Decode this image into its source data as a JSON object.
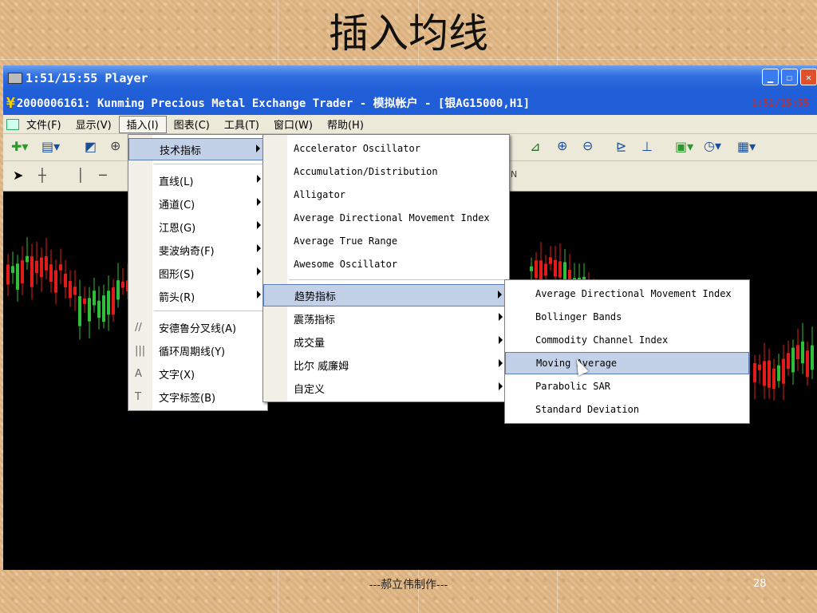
{
  "slide": {
    "title": "插入均线",
    "footer": "---郝立伟制作---",
    "page_number": "28"
  },
  "window": {
    "player_title": "1:51/15:55 Player",
    "app_title": "2000006161: Kunming Precious Metal Exchange Trader - 模拟帐户 - [银AG15000,H1]",
    "app_title_time": "1:51/15:55"
  },
  "menubar": {
    "items": [
      {
        "label": "文件(F)"
      },
      {
        "label": "显示(V)"
      },
      {
        "label": "插入(I)"
      },
      {
        "label": "图表(C)"
      },
      {
        "label": "工具(T)"
      },
      {
        "label": "窗口(W)"
      },
      {
        "label": "帮助(H)"
      }
    ]
  },
  "insert_menu": {
    "items": [
      {
        "label": "技术指标",
        "icon": ""
      },
      {
        "label": "直线(L)",
        "icon": ""
      },
      {
        "label": "通道(C)",
        "icon": ""
      },
      {
        "label": "江恩(G)",
        "icon": ""
      },
      {
        "label": "斐波纳奇(F)",
        "icon": ""
      },
      {
        "label": "图形(S)",
        "icon": ""
      },
      {
        "label": "箭头(R)",
        "icon": ""
      },
      {
        "label": "安德鲁分叉线(A)",
        "icon": "//"
      },
      {
        "label": "循环周期线(Y)",
        "icon": "|||"
      },
      {
        "label": "文字(X)",
        "icon": "A"
      },
      {
        "label": "文字标签(B)",
        "icon": "T"
      }
    ]
  },
  "indicator_menu": {
    "items": [
      {
        "label": "Accelerator Oscillator"
      },
      {
        "label": "Accumulation/Distribution"
      },
      {
        "label": "Alligator"
      },
      {
        "label": "Average Directional Movement Index"
      },
      {
        "label": "Average True Range"
      },
      {
        "label": "Awesome Oscillator"
      },
      {
        "label": "趋势指标"
      },
      {
        "label": "震荡指标"
      },
      {
        "label": "成交量"
      },
      {
        "label": "比尔 威廉姆"
      },
      {
        "label": "自定义"
      }
    ]
  },
  "trend_menu": {
    "items": [
      {
        "label": "Average Directional Movement Index"
      },
      {
        "label": "Bollinger Bands"
      },
      {
        "label": "Commodity Channel Index"
      },
      {
        "label": "Moving Average"
      },
      {
        "label": "Parabolic SAR"
      },
      {
        "label": "Standard Deviation"
      }
    ]
  },
  "colors": {
    "bull": "#2fbf3a",
    "bear": "#e21b1b",
    "title_blue": "#1f5ed6",
    "menu_highlight": "#c2d0e8"
  }
}
